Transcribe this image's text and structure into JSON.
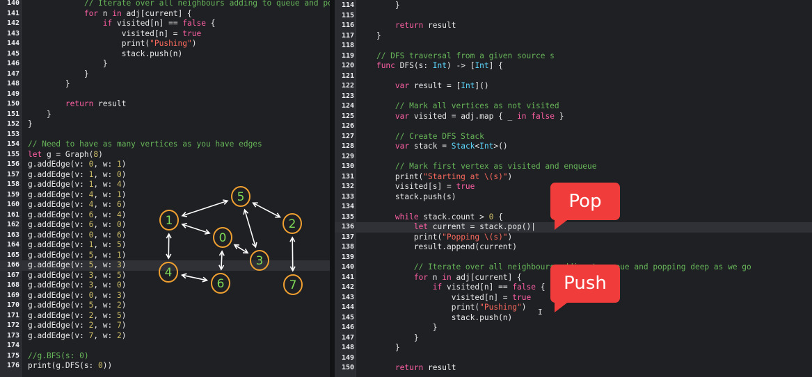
{
  "left_editor": {
    "lines": [
      {
        "n": "140",
        "t": "            // Iterate over all neighbours adding to queue and po"
      },
      {
        "n": "141",
        "t": "            for n in adj[current] {"
      },
      {
        "n": "142",
        "t": "                if visited[n] == false {"
      },
      {
        "n": "143",
        "t": "                    visited[n] = true"
      },
      {
        "n": "144",
        "t": "                    print(\"Pushing\")"
      },
      {
        "n": "145",
        "t": "                    stack.push(n)"
      },
      {
        "n": "146",
        "t": "                }"
      },
      {
        "n": "147",
        "t": "            }"
      },
      {
        "n": "148",
        "t": "        }"
      },
      {
        "n": "149",
        "t": ""
      },
      {
        "n": "150",
        "t": "        return result"
      },
      {
        "n": "151",
        "t": "    }"
      },
      {
        "n": "152",
        "t": "}"
      },
      {
        "n": "153",
        "t": ""
      },
      {
        "n": "154",
        "t": "// Need to have as many vertices as you have edges"
      },
      {
        "n": "155",
        "t": "let g = Graph(8)"
      },
      {
        "n": "156",
        "t": "g.addEdge(v: 0, w: 1)"
      },
      {
        "n": "157",
        "t": "g.addEdge(v: 1, w: 0)"
      },
      {
        "n": "158",
        "t": "g.addEdge(v: 1, w: 4)"
      },
      {
        "n": "159",
        "t": "g.addEdge(v: 4, w: 1)"
      },
      {
        "n": "160",
        "t": "g.addEdge(v: 4, w: 6)"
      },
      {
        "n": "161",
        "t": "g.addEdge(v: 6, w: 4)"
      },
      {
        "n": "162",
        "t": "g.addEdge(v: 6, w: 0)"
      },
      {
        "n": "163",
        "t": "g.addEdge(v: 0, w: 6)"
      },
      {
        "n": "164",
        "t": "g.addEdge(v: 1, w: 5)"
      },
      {
        "n": "165",
        "t": "g.addEdge(v: 5, w: 1)"
      },
      {
        "n": "166",
        "t": "g.addEdge(v: 5, w: 3)"
      },
      {
        "n": "167",
        "t": "g.addEdge(v: 3, w: 5)"
      },
      {
        "n": "168",
        "t": "g.addEdge(v: 3, w: 0)"
      },
      {
        "n": "169",
        "t": "g.addEdge(v: 0, w: 3)"
      },
      {
        "n": "170",
        "t": "g.addEdge(v: 5, w: 2)"
      },
      {
        "n": "171",
        "t": "g.addEdge(v: 2, w: 5)"
      },
      {
        "n": "172",
        "t": "g.addEdge(v: 2, w: 7)"
      },
      {
        "n": "173",
        "t": "g.addEdge(v: 7, w: 2)"
      },
      {
        "n": "174",
        "t": ""
      },
      {
        "n": "175",
        "t": "//g.BFS(s: 0)"
      },
      {
        "n": "176",
        "t": "print(g.DFS(s: 0))"
      }
    ],
    "highlighted_line": "166"
  },
  "right_editor": {
    "lines": [
      {
        "n": "114",
        "t": "        }"
      },
      {
        "n": "115",
        "t": ""
      },
      {
        "n": "116",
        "t": "        return result"
      },
      {
        "n": "117",
        "t": "    }"
      },
      {
        "n": "118",
        "t": ""
      },
      {
        "n": "119",
        "t": "    // DFS traversal from a given source s"
      },
      {
        "n": "120",
        "t": "    func DFS(s: Int) -> [Int] {"
      },
      {
        "n": "121",
        "t": ""
      },
      {
        "n": "122",
        "t": "        var result = [Int]()"
      },
      {
        "n": "123",
        "t": ""
      },
      {
        "n": "124",
        "t": "        // Mark all vertices as not visited"
      },
      {
        "n": "125",
        "t": "        var visited = adj.map { _ in false }"
      },
      {
        "n": "126",
        "t": ""
      },
      {
        "n": "127",
        "t": "        // Create DFS Stack"
      },
      {
        "n": "128",
        "t": "        var stack = Stack<Int>()"
      },
      {
        "n": "129",
        "t": ""
      },
      {
        "n": "130",
        "t": "        // Mark first vertex as visited and enqueue"
      },
      {
        "n": "131",
        "t": "        print(\"Starting at \\(s)\")"
      },
      {
        "n": "132",
        "t": "        visited[s] = true"
      },
      {
        "n": "133",
        "t": "        stack.push(s)"
      },
      {
        "n": "134",
        "t": ""
      },
      {
        "n": "135",
        "t": "        while stack.count > 0 {"
      },
      {
        "n": "136",
        "t": "            let current = stack.pop()"
      },
      {
        "n": "137",
        "t": "            print(\"Popping \\(s)\")"
      },
      {
        "n": "138",
        "t": "            result.append(current)"
      },
      {
        "n": "139",
        "t": ""
      },
      {
        "n": "140",
        "t": "            // Iterate over all neighbours adding to queue and popping deep as we go"
      },
      {
        "n": "141",
        "t": "            for n in adj[current] {"
      },
      {
        "n": "142",
        "t": "                if visited[n] == false {"
      },
      {
        "n": "143",
        "t": "                    visited[n] = true"
      },
      {
        "n": "144",
        "t": "                    print(\"Pushing\")"
      },
      {
        "n": "145",
        "t": "                    stack.push(n)"
      },
      {
        "n": "146",
        "t": "                }"
      },
      {
        "n": "147",
        "t": "            }"
      },
      {
        "n": "148",
        "t": "        }"
      },
      {
        "n": "149",
        "t": ""
      },
      {
        "n": "150",
        "t": "        return result"
      }
    ],
    "highlighted_line": "136"
  },
  "graph_nodes": [
    "0",
    "1",
    "2",
    "3",
    "4",
    "5",
    "6",
    "7"
  ],
  "annotations": {
    "pop_label": "Pop",
    "push_label": "Push"
  },
  "colors": {
    "background": "#1f2024",
    "keyword": "#fc5fa3",
    "string": "#fc6a5d",
    "number": "#d0bf69",
    "comment": "#67b659",
    "type": "#5dd8ff",
    "drawing_stroke": "#f0a030",
    "drawing_text": "#7ed957",
    "callout": "#f03c3a"
  }
}
